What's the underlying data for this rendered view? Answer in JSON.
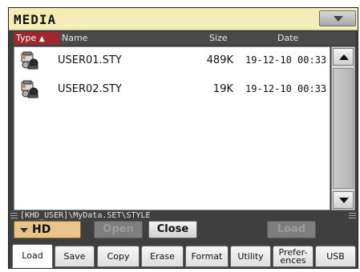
{
  "window": {
    "title": "MEDIA"
  },
  "header": {
    "type_label": "Type",
    "type_sort_arrow": "▲",
    "name_label": "Name",
    "size_label": "Size",
    "date_label": "Date"
  },
  "files": [
    {
      "icon": "style-file-icon",
      "name": "USER01.STY",
      "size": "489K",
      "date": "19-12-10 00:33"
    },
    {
      "icon": "style-file-icon",
      "name": "USER02.STY",
      "size": "19K",
      "date": "19-12-10 00:33"
    }
  ],
  "path": "[KHD_USER]\\MyData.SET\\STYLE",
  "drive": {
    "selected": "HD"
  },
  "buttons": {
    "open": "Open",
    "close": "Close",
    "load": "Load"
  },
  "tabs": [
    {
      "label": "Load",
      "active": true
    },
    {
      "label": "Save",
      "active": false
    },
    {
      "label": "Copy",
      "active": false
    },
    {
      "label": "Erase",
      "active": false
    },
    {
      "label": "Format",
      "active": false
    },
    {
      "label": "Utility",
      "active": false
    },
    {
      "label": "Prefer-\nences",
      "active": false
    },
    {
      "label": "USB",
      "active": false
    }
  ],
  "colors": {
    "title_bg": "#f3eeb8",
    "panel_bg": "#3f3f3f",
    "sort_header": "#a1272e",
    "drive_select": "#e9c48a"
  }
}
